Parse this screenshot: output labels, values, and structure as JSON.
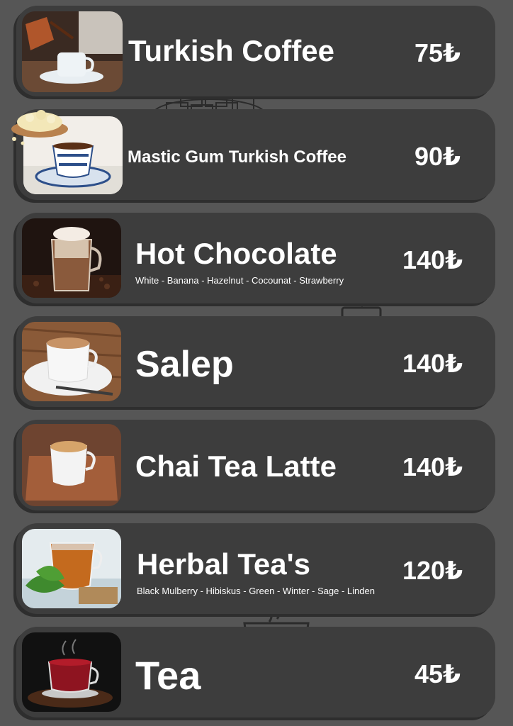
{
  "menu": {
    "items": [
      {
        "name": "Turkish Coffee",
        "price": "75₺",
        "subtitle": ""
      },
      {
        "name": "Mastic Gum Turkish Coffee",
        "price": "90₺",
        "subtitle": ""
      },
      {
        "name": "Hot Chocolate",
        "price": "140₺",
        "subtitle": "White - Banana - Hazelnut - Cocounat - Strawberry"
      },
      {
        "name": "Salep",
        "price": "140₺",
        "subtitle": ""
      },
      {
        "name": "Chai Tea Latte",
        "price": "140₺",
        "subtitle": ""
      },
      {
        "name": "Herbal Tea's",
        "price": "120₺",
        "subtitle": "Black Mulberry - Hibiskus - Green - Winter - Sage - Linden"
      },
      {
        "name": "Tea",
        "price": "45₺",
        "subtitle": ""
      }
    ]
  },
  "icons": {
    "photos": [
      "turkish-coffee-photo",
      "mastic-coffee-photo",
      "hot-chocolate-photo",
      "salep-photo",
      "chai-latte-photo",
      "herbal-tea-photo",
      "tea-photo"
    ],
    "decorations": [
      "turkish-delight-icon",
      "takeaway-cup-icon",
      "coffee-cup-icon"
    ]
  },
  "colors": {
    "background": "#565656",
    "card": "#3d3d3d",
    "text": "#ffffff"
  }
}
